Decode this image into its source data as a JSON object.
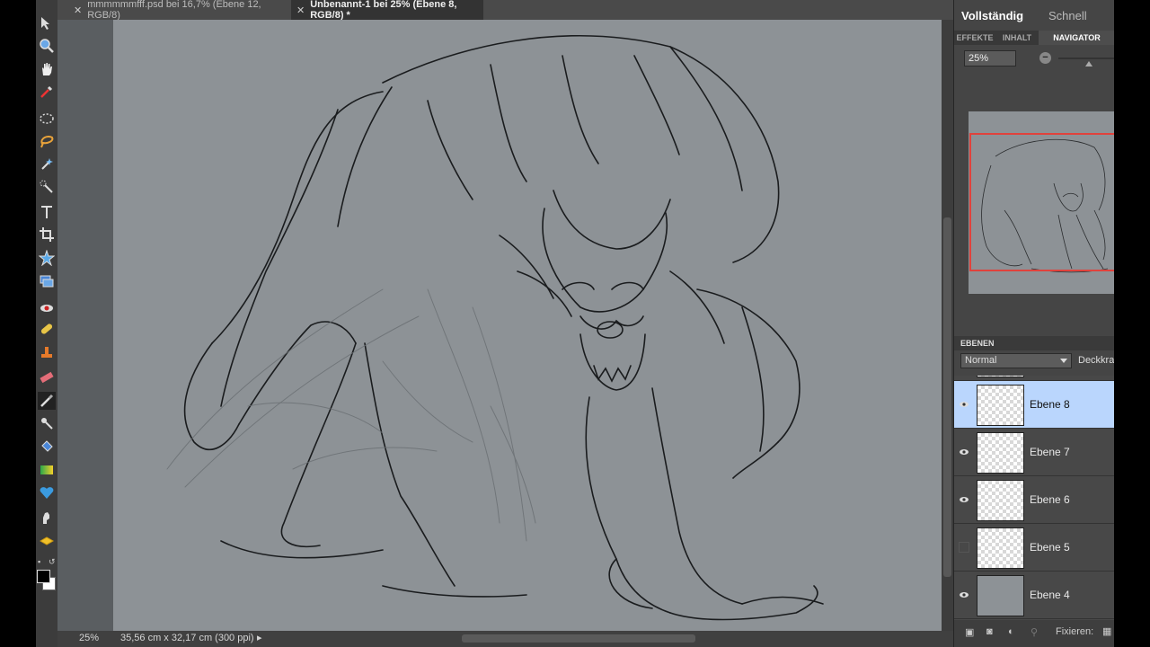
{
  "tabs": [
    {
      "label": "mmmmmmfff.psd bei 16,7% (Ebene 12, RGB/8)",
      "active": false
    },
    {
      "label": "Unbenannt-1 bei 25% (Ebene 8, RGB/8) *",
      "active": true
    }
  ],
  "status": {
    "zoom": "25%",
    "doc_size": "35,56 cm x 32,17 cm (300 ppi)"
  },
  "panel": {
    "modes": [
      "Vollständig",
      "Schnell"
    ],
    "subtabs": [
      "EFFEKTE",
      "INHALT",
      "NAVIGATOR"
    ],
    "active_subtab": "NAVIGATOR",
    "navigator_zoom": "25%"
  },
  "layers_panel": {
    "title": "EBENEN",
    "blend_mode": "Normal",
    "opacity_label": "Deckkra",
    "lock_label": "Fixieren:",
    "layers": [
      {
        "name": "Ebene 8",
        "selected": true,
        "visible": true
      },
      {
        "name": "Ebene 7",
        "selected": false,
        "visible": true
      },
      {
        "name": "Ebene 6",
        "selected": false,
        "visible": true
      },
      {
        "name": "Ebene 5",
        "selected": false,
        "visible": false
      },
      {
        "name": "Ebene 4",
        "selected": false,
        "visible": true
      }
    ]
  },
  "tools": [
    "move-icon",
    "zoom-icon",
    "hand-icon",
    "eyedropper-icon",
    "marquee-icon",
    "lasso-icon",
    "magic-wand-icon",
    "quick-selection-icon",
    "type-icon",
    "crop-icon",
    "shape-icon",
    "layer-icon",
    "red-eye-icon",
    "healing-icon",
    "stamp-icon",
    "eraser-icon",
    "brush-icon",
    "smart-brush-icon",
    "paint-bucket-icon",
    "gradient-icon",
    "custom-shape-icon",
    "smudge-icon",
    "sponge-icon"
  ],
  "colors": {
    "accent": "#bad6fd",
    "nav_box": "#e1423c",
    "canvas_bg": "#8d9296"
  }
}
